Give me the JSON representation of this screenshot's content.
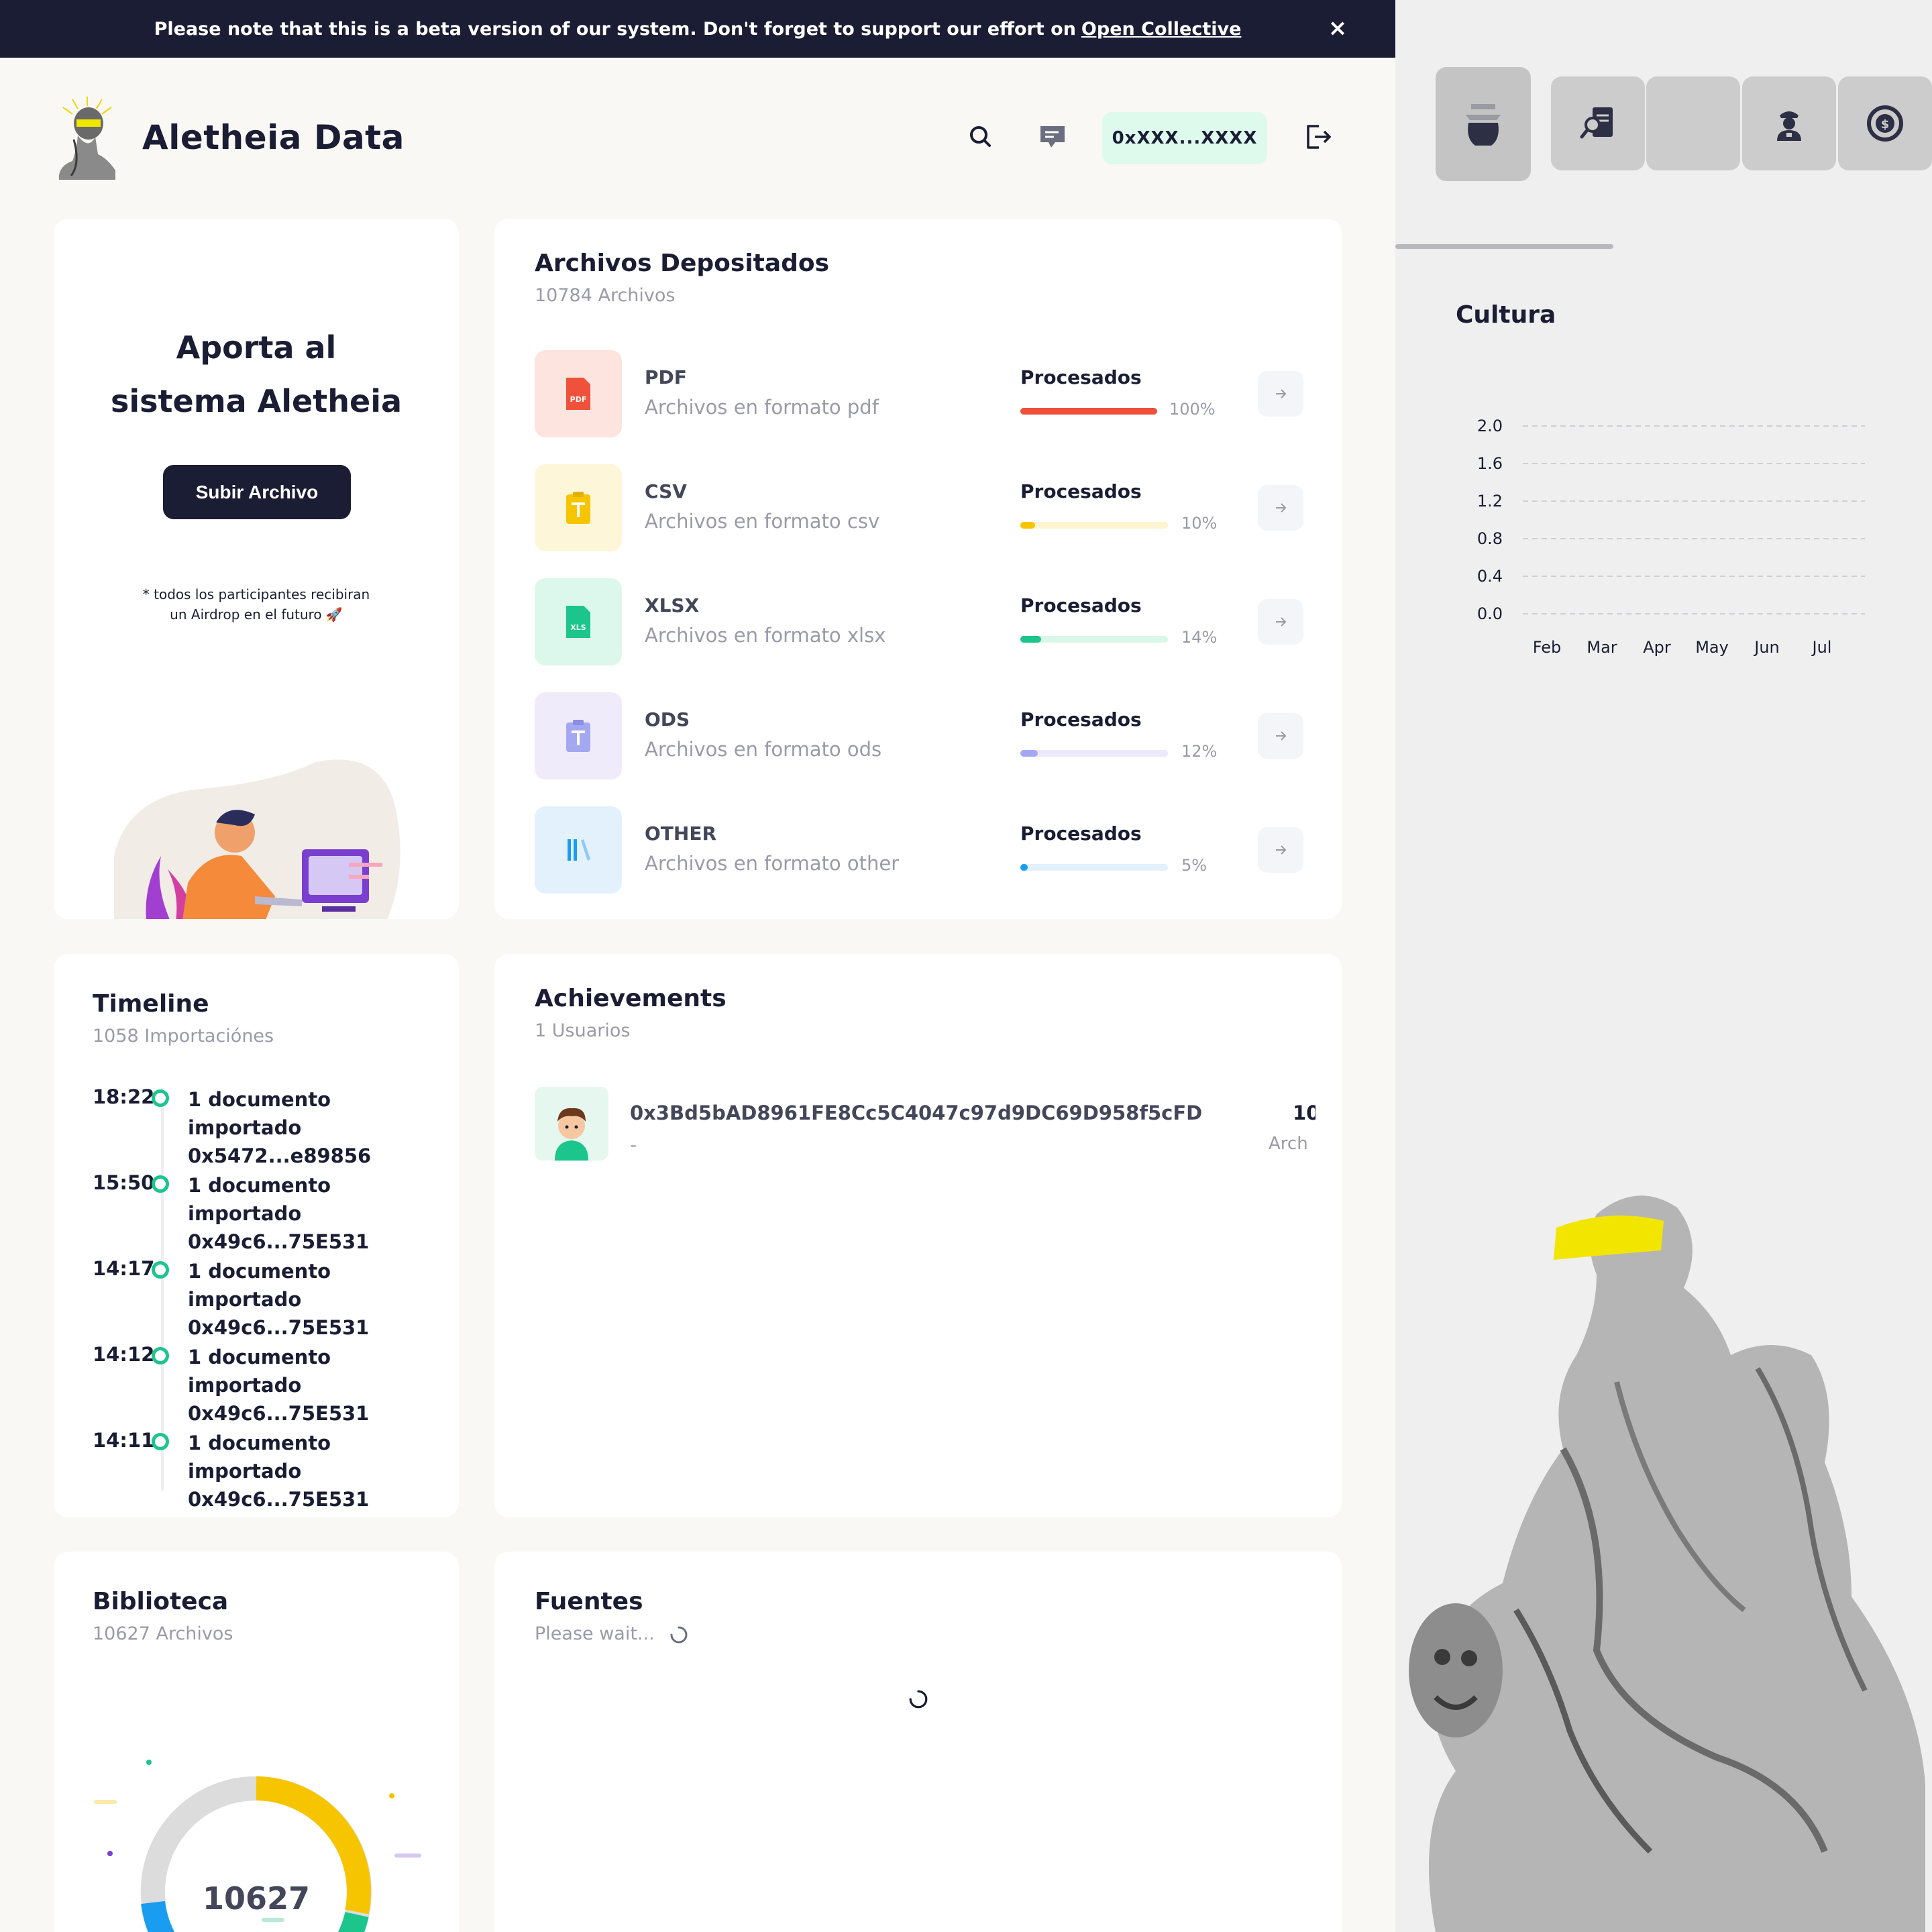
{
  "banner": {
    "text": "Please note that this is a beta version of our system. Don't forget to support our effort on",
    "link_text": "Open Collective",
    "close_label": "×"
  },
  "header": {
    "brand": "Aletheia Data",
    "wallet": "0xXXX...XXXX",
    "icons": [
      "search-icon",
      "chat-icon",
      "logout-icon"
    ]
  },
  "aporta": {
    "title_line1": "Aporta al",
    "title_line2": "sistema Aletheia",
    "button": "Subir Archivo",
    "note_line1": "* todos los participantes recibiran",
    "note_line2": "un Airdrop en el futuro 🚀"
  },
  "archivos": {
    "title": "Archivos Depositados",
    "subtitle": "10784 Archivos",
    "rows": [
      {
        "name": "PDF",
        "desc": "Archivos en formato pdf",
        "label": "Procesados",
        "percent": "100%",
        "value": 1.0,
        "color": "#f0513b",
        "track": "#fde2dd",
        "tile": "#fde4df",
        "icon": "pdf-file-icon"
      },
      {
        "name": "CSV",
        "desc": "Archivos en formato csv",
        "label": "Procesados",
        "percent": "10%",
        "value": 0.1,
        "color": "#f7c500",
        "track": "#fdf4d0",
        "tile": "#fef6d8",
        "icon": "csv-file-icon"
      },
      {
        "name": "XLSX",
        "desc": "Archivos en formato xlsx",
        "label": "Procesados",
        "percent": "14%",
        "value": 0.14,
        "color": "#1bc58b",
        "track": "#d8f7ea",
        "tile": "#dcf8ec",
        "icon": "xls-file-icon"
      },
      {
        "name": "ODS",
        "desc": "Archivos en formato ods",
        "label": "Procesados",
        "percent": "12%",
        "value": 0.12,
        "color": "#a3a8f0",
        "track": "#ece9fb",
        "tile": "#efebfb",
        "icon": "ods-file-icon"
      },
      {
        "name": "OTHER",
        "desc": "Archivos en formato other",
        "label": "Procesados",
        "percent": "5%",
        "value": 0.05,
        "color": "#1a9df0",
        "track": "#e3f1fc",
        "tile": "#e3f1fc",
        "icon": "library-icon"
      }
    ]
  },
  "timeline": {
    "title": "Timeline",
    "subtitle": "1058 Importaciónes",
    "items": [
      {
        "time": "18:22",
        "text": "1 documento importado",
        "addr": "0x5472...e89856"
      },
      {
        "time": "15:50",
        "text": "1 documento importado",
        "addr": "0x49c6...75E531"
      },
      {
        "time": "14:17",
        "text": "1 documento importado",
        "addr": "0x49c6...75E531"
      },
      {
        "time": "14:12",
        "text": "1 documento importado",
        "addr": "0x49c6...75E531"
      },
      {
        "time": "14:11",
        "text": "1 documento importado",
        "addr": "0x49c6...75E531"
      }
    ]
  },
  "achievements": {
    "title": "Achievements",
    "subtitle": "1 Usuarios",
    "user": {
      "address": "0x3Bd5bAD8961FE8Cc5C4047c97d9DC69D958f5cFD",
      "sub": "-",
      "count": "10",
      "count_label": "Arch"
    }
  },
  "biblioteca": {
    "title": "Biblioteca",
    "subtitle": "10627 Archivos",
    "total": "10627"
  },
  "fuentes": {
    "title": "Fuentes",
    "subtitle": "Please wait..."
  },
  "sidebar": {
    "categories": [
      "amphora-icon",
      "search-document-icon",
      "blank-icon",
      "police-officer-icon",
      "money-chart-icon"
    ]
  },
  "chart_data": {
    "type": "line",
    "title": "Cultura",
    "categories": [
      "Feb",
      "Mar",
      "Apr",
      "May",
      "Jun",
      "Jul"
    ],
    "series": [],
    "yticks": [
      "2.0",
      "1.6",
      "1.2",
      "0.8",
      "0.4",
      "0.0"
    ],
    "ylim": [
      0,
      2
    ],
    "grid": true
  }
}
